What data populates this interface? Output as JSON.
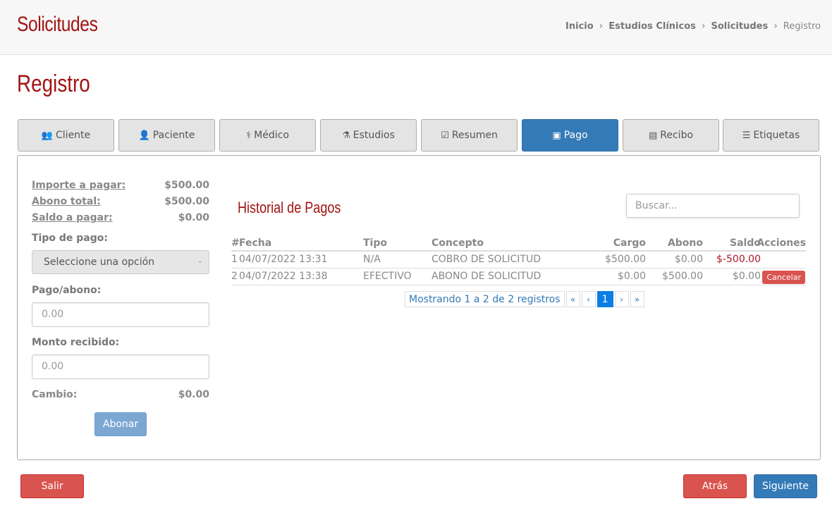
{
  "header": {
    "app_title": "Solicitudes",
    "breadcrumb": [
      "Inicio",
      "Estudios Clínicos",
      "Solicitudes",
      "Registro"
    ]
  },
  "page_title": "Registro",
  "tabs": [
    {
      "label": "Cliente",
      "icon": "users-icon"
    },
    {
      "label": "Paciente",
      "icon": "user-icon"
    },
    {
      "label": "Médico",
      "icon": "user-md-icon"
    },
    {
      "label": "Estudios",
      "icon": "flask-icon"
    },
    {
      "label": "Resumen",
      "icon": "check-square-icon"
    },
    {
      "label": "Pago",
      "icon": "money-icon",
      "active": true
    },
    {
      "label": "Recibo",
      "icon": "file-text-icon"
    },
    {
      "label": "Etiquetas",
      "icon": "barcode-icon"
    }
  ],
  "summary": {
    "importe_label": "Importe a pagar:",
    "importe_value": "$500.00",
    "abono_label": "Abono total:",
    "abono_value": "$500.00",
    "saldo_label": "Saldo a pagar:",
    "saldo_value": "$0.00"
  },
  "form": {
    "tipo_label": "Tipo de pago:",
    "tipo_selected": "Seleccione una opción",
    "pago_label": "Pago/abono:",
    "pago_placeholder": "0.00",
    "monto_label": "Monto recibido:",
    "monto_placeholder": "0.00",
    "cambio_label": "Cambio:",
    "cambio_value": "$0.00",
    "abonar_label": "Abonar"
  },
  "history": {
    "title": "Historial de Pagos",
    "search_placeholder": "Buscar...",
    "columns": {
      "num": "#",
      "fecha": "Fecha",
      "tipo": "Tipo",
      "concepto": "Concepto",
      "cargo": "Cargo",
      "abono": "Abono",
      "saldo": "Saldo",
      "acciones": "Acciones"
    },
    "rows": [
      {
        "num": "1",
        "fecha": "04/07/2022 13:31",
        "tipo": "N/A",
        "concepto": "COBRO DE SOLICITUD",
        "cargo": "$500.00",
        "abono": "$0.00",
        "saldo": "$-500.00",
        "accion": ""
      },
      {
        "num": "2",
        "fecha": "04/07/2022 13:38",
        "tipo": "EFECTIVO",
        "concepto": "ABONO DE SOLICITUD",
        "cargo": "$0.00",
        "abono": "$500.00",
        "saldo": "$0.00",
        "accion": "Cancelar"
      }
    ],
    "pager": {
      "info": "Mostrando 1 a 2 de 2 registros",
      "first": "«",
      "prev": "‹",
      "current": "1",
      "next": "›",
      "last": "»"
    }
  },
  "footer": {
    "salir": "Salir",
    "atras": "Atrás",
    "siguiente": "Siguiente"
  },
  "colors": {
    "brand_red": "#a11414",
    "primary": "#337ab7",
    "danger": "#d9534f"
  }
}
